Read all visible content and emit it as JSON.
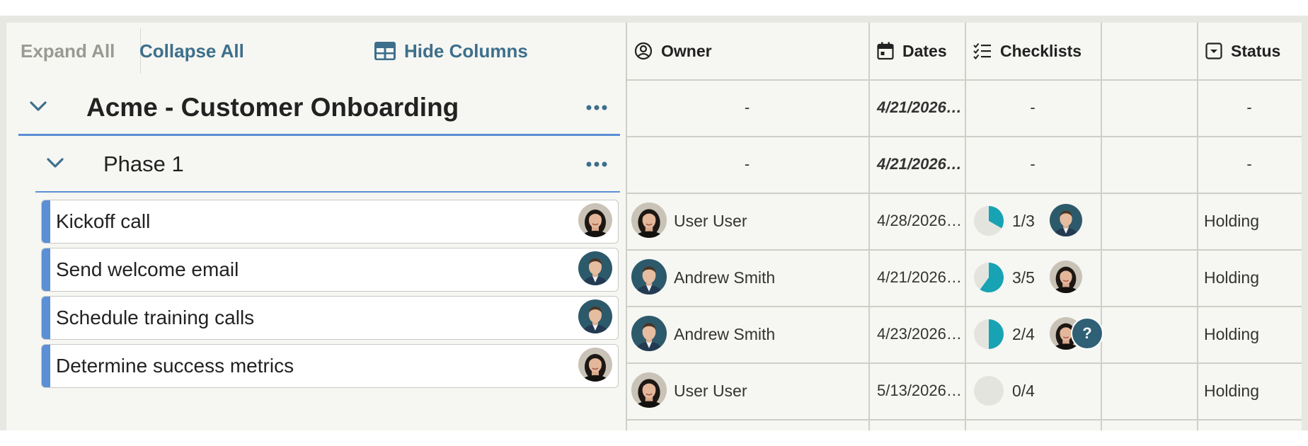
{
  "toolbar": {
    "expand_all": "Expand All",
    "collapse_all": "Collapse All",
    "hide_columns": "Hide Columns"
  },
  "columns": {
    "owner": "Owner",
    "dates": "Dates",
    "checklists": "Checklists",
    "status": "Status"
  },
  "project": {
    "title": "Acme - Customer Onboarding",
    "owner": "-",
    "date": "4/21/2026…",
    "checklist": "-",
    "status": "-"
  },
  "phase": {
    "title": "Phase 1",
    "owner": "-",
    "date": "4/21/2026…",
    "checklist": "-",
    "status": "-"
  },
  "tasks": [
    {
      "name": "Kickoff call",
      "owner": "User User",
      "date": "4/28/2026…",
      "checklist": "1/3",
      "done": 1,
      "total": 3,
      "status": "Holding"
    },
    {
      "name": "Send welcome email",
      "owner": "Andrew Smith",
      "date": "4/21/2026…",
      "checklist": "3/5",
      "done": 3,
      "total": 5,
      "status": "Holding"
    },
    {
      "name": "Schedule training calls",
      "owner": "Andrew Smith",
      "date": "4/23/2026…",
      "checklist": "2/4",
      "done": 2,
      "total": 4,
      "status": "Holding"
    },
    {
      "name": "Determine success metrics",
      "owner": "User User",
      "date": "5/13/2026…",
      "checklist": "0/4",
      "done": 0,
      "total": 4,
      "status": "Holding"
    }
  ],
  "unassigned_marker": "?",
  "colors": {
    "accent": "#3d6f8c",
    "task_accent": "#5b8fd6",
    "progress": "#17a3b4",
    "progress_track": "#e4e4df"
  }
}
